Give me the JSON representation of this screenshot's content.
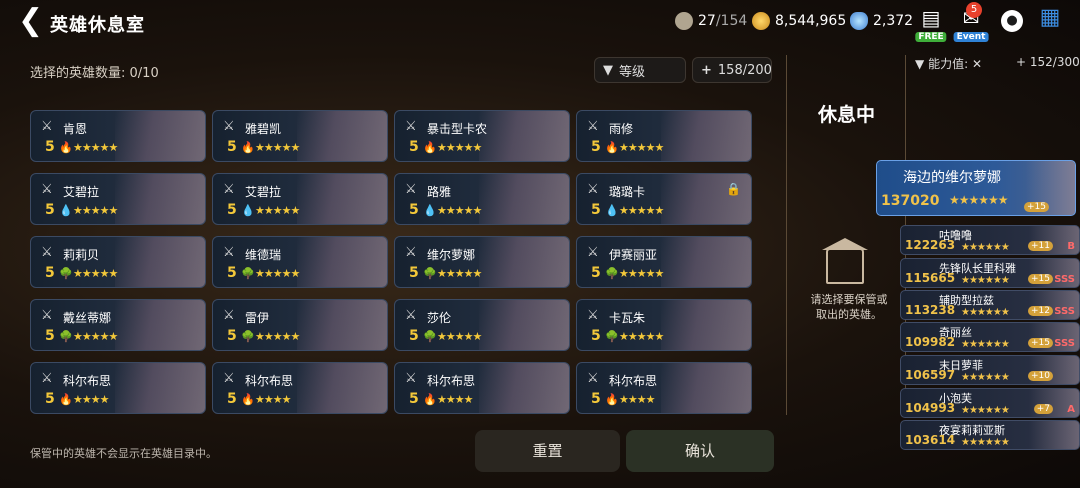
{
  "header": {
    "title": "英雄休息室",
    "capacity_current": "27",
    "capacity_max": "/154",
    "gold": "8,544,965",
    "crystal": "2,372",
    "free_label": "FREE",
    "event_label": "Event",
    "notif_count": "5"
  },
  "left": {
    "selected_label": "选择的英雄数量",
    "selected_value": ": 0/10",
    "sort_label": "等级",
    "slots_value": "158/200",
    "note": "保管中的英雄不会显示在英雄目录中。",
    "reset_label": "重置",
    "confirm_label": "确认"
  },
  "heroes": [
    {
      "name": "肯恩",
      "level": "5",
      "element": "fire",
      "stars": "★★★★★",
      "locked": false
    },
    {
      "name": "雅碧凯",
      "level": "5",
      "element": "fire",
      "stars": "★★★★★",
      "locked": false
    },
    {
      "name": "暴击型卡农",
      "level": "5",
      "element": "fire",
      "stars": "★★★★★",
      "locked": false
    },
    {
      "name": "雨修",
      "level": "5",
      "element": "fire",
      "stars": "★★★★★",
      "locked": false
    },
    {
      "name": "艾碧拉",
      "level": "5",
      "element": "water",
      "stars": "★★★★★",
      "locked": false
    },
    {
      "name": "艾碧拉",
      "level": "5",
      "element": "water",
      "stars": "★★★★★",
      "locked": false
    },
    {
      "name": "路雅",
      "level": "5",
      "element": "water",
      "stars": "★★★★★",
      "locked": false
    },
    {
      "name": "璐璐卡",
      "level": "5",
      "element": "water",
      "stars": "★★★★★",
      "locked": true
    },
    {
      "name": "莉莉贝",
      "level": "5",
      "element": "earth",
      "stars": "★★★★★",
      "locked": false
    },
    {
      "name": "维德瑞",
      "level": "5",
      "element": "earth",
      "stars": "★★★★★",
      "locked": false
    },
    {
      "name": "维尔萝娜",
      "level": "5",
      "element": "earth",
      "stars": "★★★★★",
      "locked": false
    },
    {
      "name": "伊赛丽亚",
      "level": "5",
      "element": "earth",
      "stars": "★★★★★",
      "locked": false
    },
    {
      "name": "戴丝蒂娜",
      "level": "5",
      "element": "earth",
      "stars": "★★★★★",
      "locked": false
    },
    {
      "name": "雷伊",
      "level": "5",
      "element": "earth",
      "stars": "★★★★★",
      "locked": false
    },
    {
      "name": "莎伦",
      "level": "5",
      "element": "earth",
      "stars": "★★★★★",
      "locked": false
    },
    {
      "name": "卡瓦朱",
      "level": "5",
      "element": "earth",
      "stars": "★★★★★",
      "locked": false
    },
    {
      "name": "科尔布思",
      "level": "5",
      "element": "fire",
      "stars": "★★★★",
      "locked": false
    },
    {
      "name": "科尔布思",
      "level": "5",
      "element": "fire",
      "stars": "★★★★",
      "locked": false
    },
    {
      "name": "科尔布思",
      "level": "5",
      "element": "fire",
      "stars": "★★★★",
      "locked": false
    },
    {
      "name": "科尔布思",
      "level": "5",
      "element": "fire",
      "stars": "★★★★",
      "locked": false
    }
  ],
  "middle": {
    "title": "休息中",
    "hint": "请选择要保管或取出的英雄。"
  },
  "right": {
    "sort_label": "能力值:",
    "count": "152/300",
    "list": [
      {
        "name": "海边的维尔萝娜",
        "cp": "137020",
        "plus": "+15",
        "tier": ""
      },
      {
        "name": "咕噜噜",
        "cp": "122263",
        "plus": "+11",
        "tier": "B"
      },
      {
        "name": "先锋队长里科雅",
        "cp": "115665",
        "plus": "+15",
        "tier": "SSS"
      },
      {
        "name": "辅助型拉兹",
        "cp": "113238",
        "plus": "+12",
        "tier": "SSS"
      },
      {
        "name": "奇丽丝",
        "cp": "109982",
        "plus": "+15",
        "tier": "SSS"
      },
      {
        "name": "末日萝菲",
        "cp": "106597",
        "plus": "+10",
        "tier": ""
      },
      {
        "name": "小泡芙",
        "cp": "104993",
        "plus": "+7",
        "tier": "A"
      },
      {
        "name": "夜宴莉莉亚斯",
        "cp": "103614",
        "plus": "",
        "tier": ""
      }
    ]
  },
  "colors": {
    "gold": "#f3c83a",
    "fire": "#e2442a",
    "water": "#3d9be8",
    "earth": "#49b03a"
  }
}
